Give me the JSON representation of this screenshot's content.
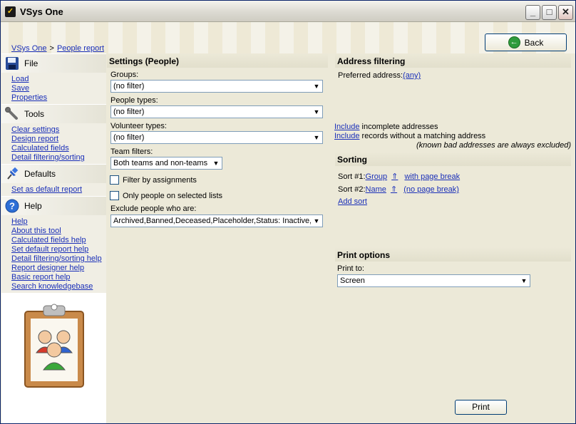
{
  "window": {
    "title": "VSys One"
  },
  "breadcrumb": {
    "root": "VSys One",
    "separator": ">",
    "current": "People report"
  },
  "back_button": {
    "label": "Back"
  },
  "sidebar": {
    "file": {
      "title": "File",
      "items": [
        "Load",
        "Save",
        "Properties"
      ]
    },
    "tools": {
      "title": "Tools",
      "items": [
        "Clear settings",
        "Design report",
        "Calculated fields",
        "Detail filtering/sorting"
      ]
    },
    "defaults": {
      "title": "Defaults",
      "items": [
        "Set as default report"
      ]
    },
    "help": {
      "title": "Help",
      "items": [
        "Help",
        "About this tool",
        "Calculated fields help",
        "Set default report help",
        "Detail filtering/sorting help",
        "Report designer help",
        "Basic report help",
        "Search knowledgebase"
      ]
    }
  },
  "settings": {
    "title": "Settings (People)",
    "groups_label": "Groups:",
    "groups_value": "(no filter)",
    "people_types_label": "People types:",
    "people_types_value": "(no filter)",
    "volunteer_types_label": "Volunteer types:",
    "volunteer_types_value": "(no filter)",
    "team_filters_label": "Team filters:",
    "team_filters_value": "Both teams and non-teams",
    "filter_by_assignments": "Filter by assignments",
    "only_selected_lists": "Only people on selected lists",
    "exclude_label": "Exclude people who are:",
    "exclude_value": "Archived,Banned,Deceased,Placeholder,Status: Inactive,"
  },
  "address": {
    "title": "Address filtering",
    "preferred_label": "Preferred address:",
    "preferred_value": "(any)",
    "incomplete_link": "Include",
    "incomplete_text": " incomplete addresses",
    "nomatch_link": "Include",
    "nomatch_text": " records without a matching address",
    "note": "(known bad addresses are always excluded)"
  },
  "sorting": {
    "title": "Sorting",
    "sort1_label": "Sort #1:",
    "sort1_field": "Group",
    "sort1_break": "with page break",
    "sort2_label": "Sort #2:",
    "sort2_field": "Name",
    "sort2_break": "(no page break)",
    "add_sort": "Add sort",
    "direction_glyph": "⇑"
  },
  "print_options": {
    "title": "Print options",
    "print_to_label": "Print to:",
    "print_to_value": "Screen"
  },
  "print_button": {
    "label": "Print"
  }
}
